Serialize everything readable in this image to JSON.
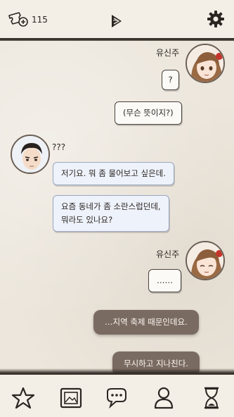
{
  "header": {
    "ticket_icon": "ticket-plus-icon",
    "ticket_count": "115",
    "logo_icon": "pen-nib-icon",
    "settings_icon": "gear-icon"
  },
  "messages": [
    {
      "type": "name",
      "text": "유신주"
    },
    {
      "type": "me",
      "text": "?"
    },
    {
      "type": "me",
      "text": "(무슨 뜻이지?)"
    },
    {
      "type": "name",
      "text": "???"
    },
    {
      "type": "other",
      "text": "저기요. 뭐 좀 물어보고 싶은데."
    },
    {
      "type": "other",
      "lines": [
        "요즘 동네가 좀 소란스럽던데,",
        "뭐라도 있나요?"
      ]
    },
    {
      "type": "name",
      "text": "유신주"
    },
    {
      "type": "me",
      "text": "……"
    },
    {
      "type": "narration",
      "text": "…지역 축제 때문인데요."
    },
    {
      "type": "narration",
      "text": "무시하고 지나친다."
    }
  ],
  "bottom_nav": [
    {
      "icon": "star-icon"
    },
    {
      "icon": "album-icon"
    },
    {
      "icon": "chat-icon"
    },
    {
      "icon": "person-icon"
    },
    {
      "icon": "hourglass-icon"
    }
  ],
  "colors": {
    "bar_bg": "#f3eee6",
    "paper_bg": "#ece6dc",
    "narration_bg": "#7a6b62",
    "other_bubble_bg": "#eef2fb",
    "accent_dark": "#2b2622"
  }
}
